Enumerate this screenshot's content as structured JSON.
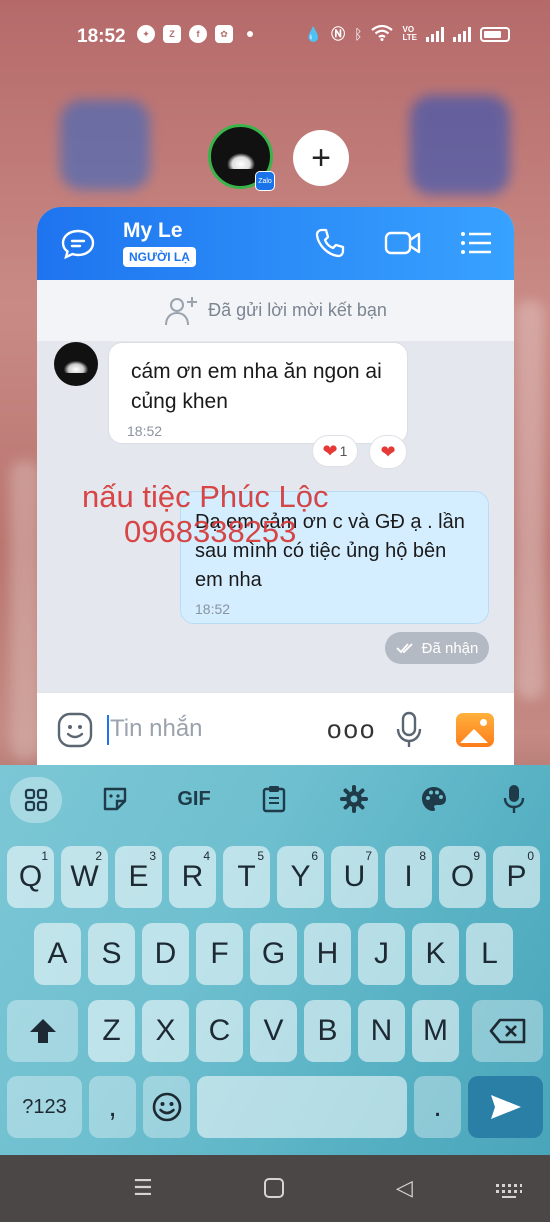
{
  "status_bar": {
    "time": "18:52",
    "left_icons": [
      "messenger-icon",
      "zalo-icon",
      "facebook-icon",
      "photos-icon"
    ],
    "right_icons": [
      "data-saver-icon",
      "nfc-icon",
      "bluetooth-icon",
      "wifi-icon",
      "volte-icon",
      "signal-icon",
      "signal-icon",
      "battery-icon"
    ],
    "volte": "VO\nLTE"
  },
  "bubble": {
    "badge": "Zalo",
    "plus": "+"
  },
  "chat": {
    "contact_name": "My Le",
    "contact_tag": "NGƯỜI LẠ",
    "friend_request_text": "Đã gửi lời mời kết bạn",
    "messages": [
      {
        "direction": "in",
        "text": "cám ơn em nha ăn ngon ai củng khen",
        "time": "18:52",
        "reactions": [
          {
            "icon": "heart-icon",
            "count": "1"
          },
          {
            "icon": "heart-icon",
            "count": ""
          }
        ]
      },
      {
        "direction": "out",
        "text": "Dạ em cảm ơn c và GĐ ạ . lần sau mình có tiệc ủng hộ bên em nha",
        "time": "18:52",
        "status": "Đã nhận"
      }
    ],
    "watermark_line1": "nấu tiệc Phúc Lộc",
    "watermark_line2": "0968338253",
    "input_placeholder": "Tin nhắn",
    "more_label": "ooo"
  },
  "keyboard": {
    "toolbar": {
      "gif_label": "GIF"
    },
    "row1": [
      {
        "k": "Q",
        "n": "1"
      },
      {
        "k": "W",
        "n": "2"
      },
      {
        "k": "E",
        "n": "3"
      },
      {
        "k": "R",
        "n": "4"
      },
      {
        "k": "T",
        "n": "5"
      },
      {
        "k": "Y",
        "n": "6"
      },
      {
        "k": "U",
        "n": "7"
      },
      {
        "k": "I",
        "n": "8"
      },
      {
        "k": "O",
        "n": "9"
      },
      {
        "k": "P",
        "n": "0"
      }
    ],
    "row2": [
      "A",
      "S",
      "D",
      "F",
      "G",
      "H",
      "J",
      "K",
      "L"
    ],
    "row3": [
      "Z",
      "X",
      "C",
      "V",
      "B",
      "N",
      "M"
    ],
    "symbols_label": "?123",
    "comma_label": ",",
    "period_label": "."
  },
  "colors": {
    "header_blue": "#1e74ef",
    "outgoing_bubble": "#d5eeff",
    "watermark_red": "#d63838",
    "heart": "#e53935"
  }
}
